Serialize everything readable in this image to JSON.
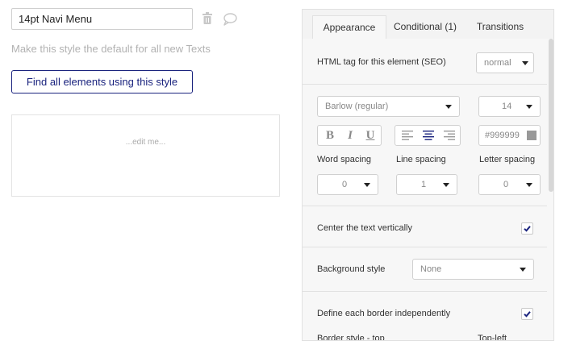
{
  "style_editor": {
    "name_value": "14pt Navi Menu",
    "default_text": "Make this style the default for all new Texts",
    "find_button": "Find all elements using this style",
    "preview_text": "...edit me..."
  },
  "panel": {
    "tabs": [
      {
        "label": "Appearance",
        "active": true
      },
      {
        "label": "Conditional (1)",
        "active": false
      },
      {
        "label": "Transitions",
        "active": false
      }
    ],
    "html_tag": {
      "label": "HTML tag for this element (SEO)",
      "value": "normal"
    },
    "font": {
      "family": "Barlow (regular)",
      "size": "14"
    },
    "format_buttons": {
      "bold": "B",
      "italic": "I",
      "underline": "U"
    },
    "color": {
      "value": "#999999",
      "swatch": "#999999"
    },
    "spacing": {
      "word_label": "Word spacing",
      "word_value": "0",
      "line_label": "Line spacing",
      "line_value": "1",
      "letter_label": "Letter spacing",
      "letter_value": "0"
    },
    "center_vertically": {
      "label": "Center the text vertically",
      "checked": true
    },
    "background_style": {
      "label": "Background style",
      "value": "None"
    },
    "border_independent": {
      "label": "Define each border independently",
      "checked": true
    },
    "border_style_top": {
      "label": "Border style - top"
    },
    "top_left": {
      "label": "Top-left"
    }
  },
  "colors": {
    "accent": "#1a237e",
    "check": "#1a237e"
  }
}
